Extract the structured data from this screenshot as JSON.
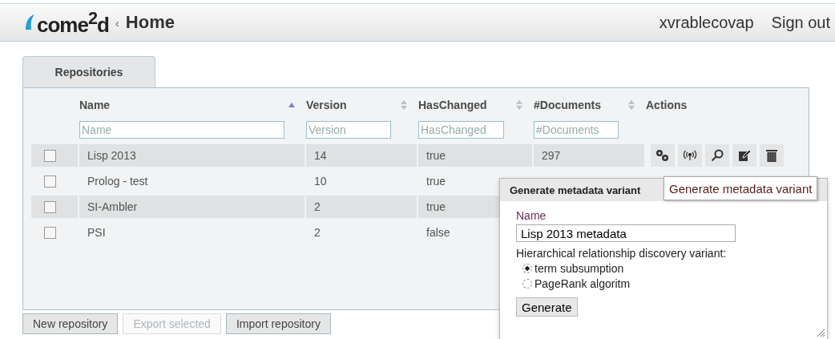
{
  "header": {
    "logo": "come$^{2}$d",
    "breadcrumb_sep": "‹",
    "title": "Home",
    "user": "xvrablecovap",
    "sign_out": "Sign out"
  },
  "tabs": [
    {
      "label": "Repositories",
      "selected": true
    }
  ],
  "table": {
    "columns": [
      {
        "label": "Name",
        "placeholder": "Name",
        "sorted": true
      },
      {
        "label": "Version",
        "placeholder": "Version",
        "sorted": false
      },
      {
        "label": "HasChanged",
        "placeholder": "HasChanged",
        "sorted": false
      },
      {
        "label": "#Documents",
        "placeholder": "#Documents",
        "sorted": false
      },
      {
        "label": "Actions"
      }
    ],
    "rows": [
      {
        "checked": false,
        "cells": [
          "Lisp 2013",
          "14",
          "true",
          "297"
        ]
      },
      {
        "checked": false,
        "cells": [
          "Prolog - test",
          "10",
          "true"
        ]
      },
      {
        "checked": false,
        "cells": [
          "SI-Ambler",
          "2",
          "true"
        ]
      },
      {
        "checked": false,
        "cells": [
          "PSI",
          "2",
          "false"
        ]
      }
    ]
  },
  "buttons": [
    {
      "label": "New repository",
      "disabled": false
    },
    {
      "label": "Export selected",
      "disabled": true
    },
    {
      "label": "Import repository",
      "disabled": false
    }
  ],
  "dialog": {
    "title": "Generate metadata variant",
    "name_label": "Name",
    "name_value": "Lisp 2013 metadata",
    "question": "Hierarchical relationship discovery variant:",
    "options": [
      {
        "label": "term subsumption",
        "selected": true
      },
      {
        "label": "PageRank algoritm",
        "selected": false
      }
    ],
    "button": "Generate"
  },
  "tooltip": "Generate metadata variant"
}
